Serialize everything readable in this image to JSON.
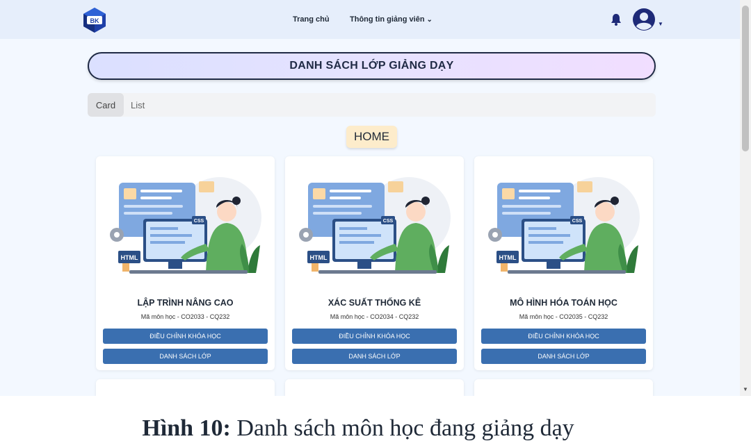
{
  "navbar": {
    "home_label": "Trang chủ",
    "info_label": "Thông tin giảng viên",
    "logo_text": "BK",
    "icons": [
      "logo-icon",
      "chevron-down-icon",
      "bell-icon",
      "user-avatar-icon"
    ]
  },
  "page": {
    "title": "DANH SÁCH LỚP GIẢNG DẠY",
    "view_toggle": {
      "card_label": "Card",
      "list_label": "List",
      "selected": "Card"
    },
    "home_badge": "HOME"
  },
  "courses": [
    {
      "name": "LẬP TRÌNH NÂNG CAO",
      "code": "Mã môn học - CO2033 - CQ232",
      "edit_label": "ĐIỀU CHỈNH KHÓA HỌC",
      "list_label": "DANH SÁCH LỚP"
    },
    {
      "name": "XÁC SUẤT THỐNG KÊ",
      "code": "Mã môn học - CO2034 - CQ232",
      "edit_label": "ĐIỀU CHỈNH KHÓA HỌC",
      "list_label": "DANH SÁCH LỚP"
    },
    {
      "name": "MÔ HÌNH HÓA TOÁN HỌC",
      "code": "Mã môn học - CO2035 - CQ232",
      "edit_label": "ĐIỀU CHỈNH KHÓA HỌC",
      "list_label": "DANH SÁCH LỚP"
    }
  ],
  "illustration": {
    "html_label": "HTML",
    "css_label": "CSS"
  },
  "caption": {
    "bold": "Hình 10:",
    "text": "Danh sách môn học đang giảng dạy"
  },
  "colors": {
    "accent": "#3a6fb0",
    "brand_navy": "#1e2a78",
    "badge": "#fdeccb",
    "navbar": "#e6eefb"
  }
}
